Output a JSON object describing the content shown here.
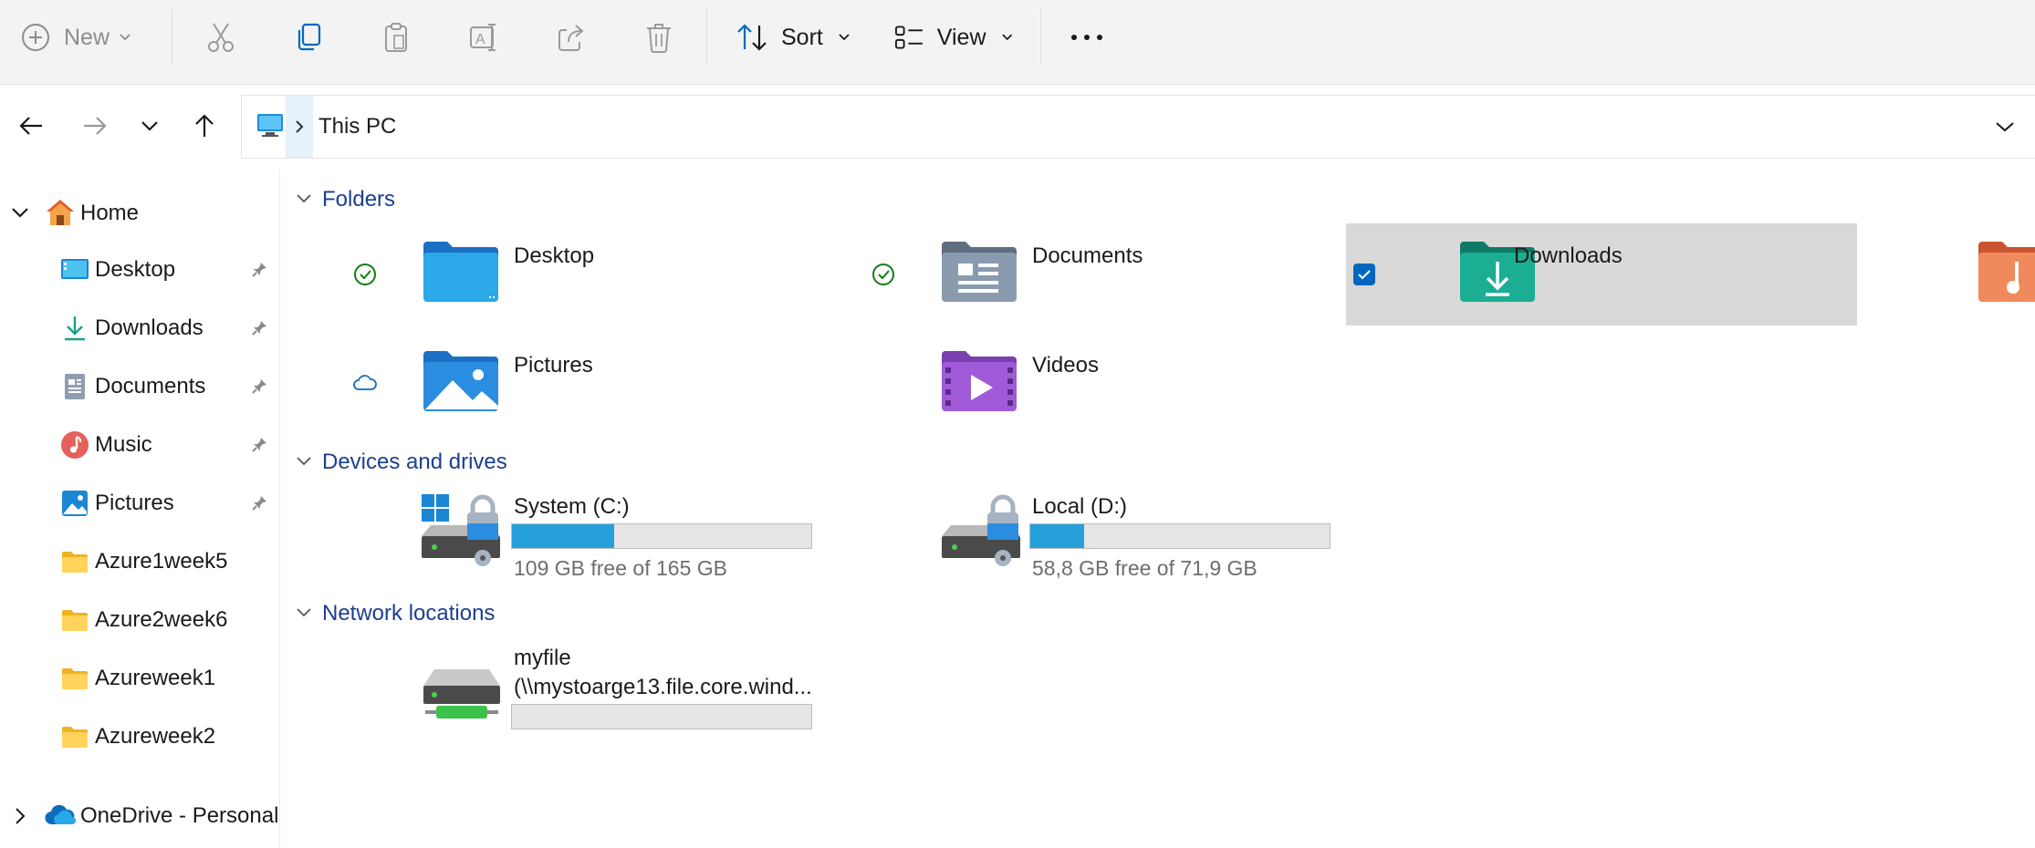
{
  "toolbar": {
    "new_label": "New",
    "sort_label": "Sort",
    "view_label": "View"
  },
  "address": {
    "location": "This PC"
  },
  "sidebar": {
    "home": "Home",
    "items": [
      {
        "label": "Desktop",
        "icon": "desktop-icon",
        "pinned": true
      },
      {
        "label": "Downloads",
        "icon": "downloads-icon",
        "pinned": true
      },
      {
        "label": "Documents",
        "icon": "documents-icon",
        "pinned": true
      },
      {
        "label": "Music",
        "icon": "music-icon",
        "pinned": true
      },
      {
        "label": "Pictures",
        "icon": "pictures-icon",
        "pinned": true
      },
      {
        "label": "Azure1week5",
        "icon": "folder-icon",
        "pinned": false
      },
      {
        "label": "Azure2week6",
        "icon": "folder-icon",
        "pinned": false
      },
      {
        "label": "Azureweek1",
        "icon": "folder-icon",
        "pinned": false
      },
      {
        "label": "Azureweek2",
        "icon": "folder-icon",
        "pinned": false
      }
    ],
    "onedrive": "OneDrive - Personal"
  },
  "content": {
    "sections": {
      "folders": "Folders",
      "devices": "Devices and drives",
      "network": "Network locations"
    },
    "folders": [
      {
        "name": "Desktop",
        "status": "synced"
      },
      {
        "name": "Documents",
        "status": "synced"
      },
      {
        "name": "Downloads",
        "status": "selected"
      },
      {
        "name": "Pictures",
        "status": "cloud"
      },
      {
        "name": "Videos",
        "status": ""
      }
    ],
    "drives": [
      {
        "name": "System (C:)",
        "free_text": "109 GB free of 165 GB",
        "used_fraction": 0.34
      },
      {
        "name": "Local (D:)",
        "free_text": "58,8 GB free of 71,9 GB",
        "used_fraction": 0.18
      }
    ],
    "network": [
      {
        "name_line1": "myfile",
        "name_line2": "(\\\\mystoarge13.file.core.wind...",
        "used_fraction": 0
      }
    ]
  },
  "colors": {
    "accent": "#0067c0",
    "section_title": "#1b3f8f",
    "selection_bg": "#d9d9d9",
    "drive_fill": "#26a0da",
    "sync_green": "#107c10"
  }
}
